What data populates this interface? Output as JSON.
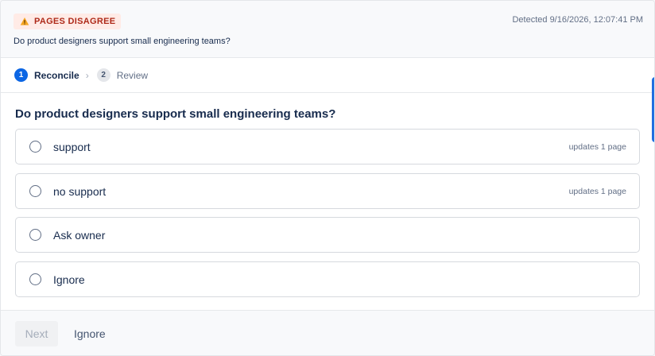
{
  "header": {
    "badge_label": "PAGES DISAGREE",
    "badge_icon": "warning-icon",
    "detected": "Detected 9/16/2026, 12:07:41 PM",
    "question": "Do product designers support small engineering teams?"
  },
  "stepper": {
    "steps": [
      {
        "number": "1",
        "label": "Reconcile",
        "state": "active"
      },
      {
        "number": "2",
        "label": "Review",
        "state": "inactive"
      }
    ],
    "separator": "›"
  },
  "main": {
    "question": "Do product designers support small engineering teams?",
    "options": [
      {
        "label": "support",
        "meta": "updates 1 page"
      },
      {
        "label": "no support",
        "meta": "updates 1 page"
      },
      {
        "label": "Ask owner",
        "meta": ""
      },
      {
        "label": "Ignore",
        "meta": ""
      }
    ]
  },
  "footer": {
    "next_label": "Next",
    "ignore_label": "Ignore"
  },
  "colors": {
    "accent": "#0c66e4",
    "badge_bg": "#ffebe6",
    "badge_text": "#ae2a19"
  }
}
